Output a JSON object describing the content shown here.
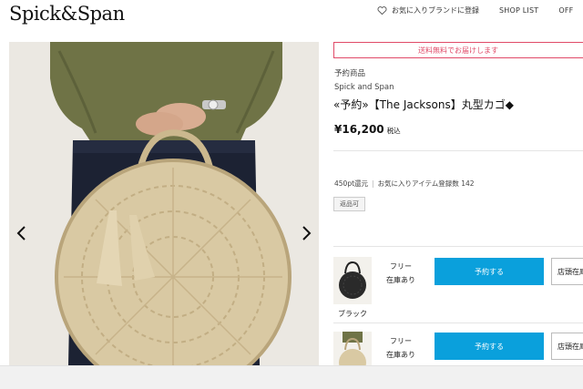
{
  "header": {
    "logo": "Spick&Span",
    "nav": {
      "favorite_brand": "お気に入りブランドに登録",
      "shop_list": "SHOP LIST",
      "off_label": "OFF"
    }
  },
  "gallery": {
    "image_alt": "丸型カゴ",
    "prev_icon": "chevron-left-icon",
    "next_icon": "chevron-right-icon"
  },
  "product": {
    "shipping_banner": "送料無料でお届けします",
    "preorder_label": "予約商品",
    "brand": "Spick and Span",
    "title": "«予約»【The Jacksons】丸型カゴ◆",
    "price": "¥16,200",
    "tax_label": "税込",
    "points": "450pt還元",
    "favorites": "お気に入りアイテム登録数 142",
    "return_badge": "返品可"
  },
  "variants": [
    {
      "color": "ブラック",
      "size": "フリー",
      "stock": "在庫あり",
      "reserve_label": "予約する",
      "store_stock_label": "店頭在庫"
    },
    {
      "color": "",
      "size": "フリー",
      "stock": "在庫あり",
      "reserve_label": "予約する",
      "store_stock_label": "店頭在庫"
    }
  ],
  "colors": {
    "accent_pink": "#e04a68",
    "reserve_blue": "#0aa0dc"
  }
}
